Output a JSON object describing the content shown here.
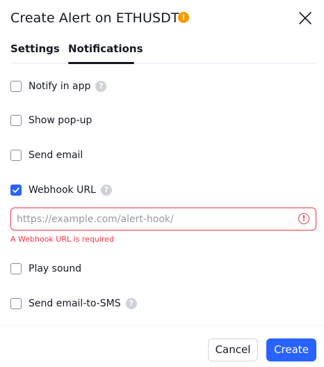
{
  "header": {
    "title": "Create Alert on ETHUSDT",
    "warning_glyph": "!",
    "warning_color": "#ff9800"
  },
  "tabs": [
    {
      "label": "Settings",
      "active": false
    },
    {
      "label": "Notifications",
      "active": true
    }
  ],
  "options": {
    "notify_in_app": {
      "label": "Notify in app",
      "checked": false,
      "has_help": true
    },
    "show_popup": {
      "label": "Show pop-up",
      "checked": false
    },
    "send_email": {
      "label": "Send email",
      "checked": false
    },
    "webhook_url": {
      "label": "Webhook URL",
      "checked": true,
      "has_help": true
    },
    "play_sound": {
      "label": "Play sound",
      "checked": false
    },
    "send_email_to_sms": {
      "label": "Send email-to-SMS",
      "checked": false,
      "has_help": true
    }
  },
  "webhook_field": {
    "value": "",
    "placeholder": "https://example.com/alert-hook/",
    "error": "A Webhook URL is required"
  },
  "help_glyph": "?",
  "footer": {
    "cancel_label": "Cancel",
    "create_label": "Create"
  },
  "colors": {
    "accent": "#2962ff",
    "error": "#f23645",
    "text": "#131722"
  }
}
